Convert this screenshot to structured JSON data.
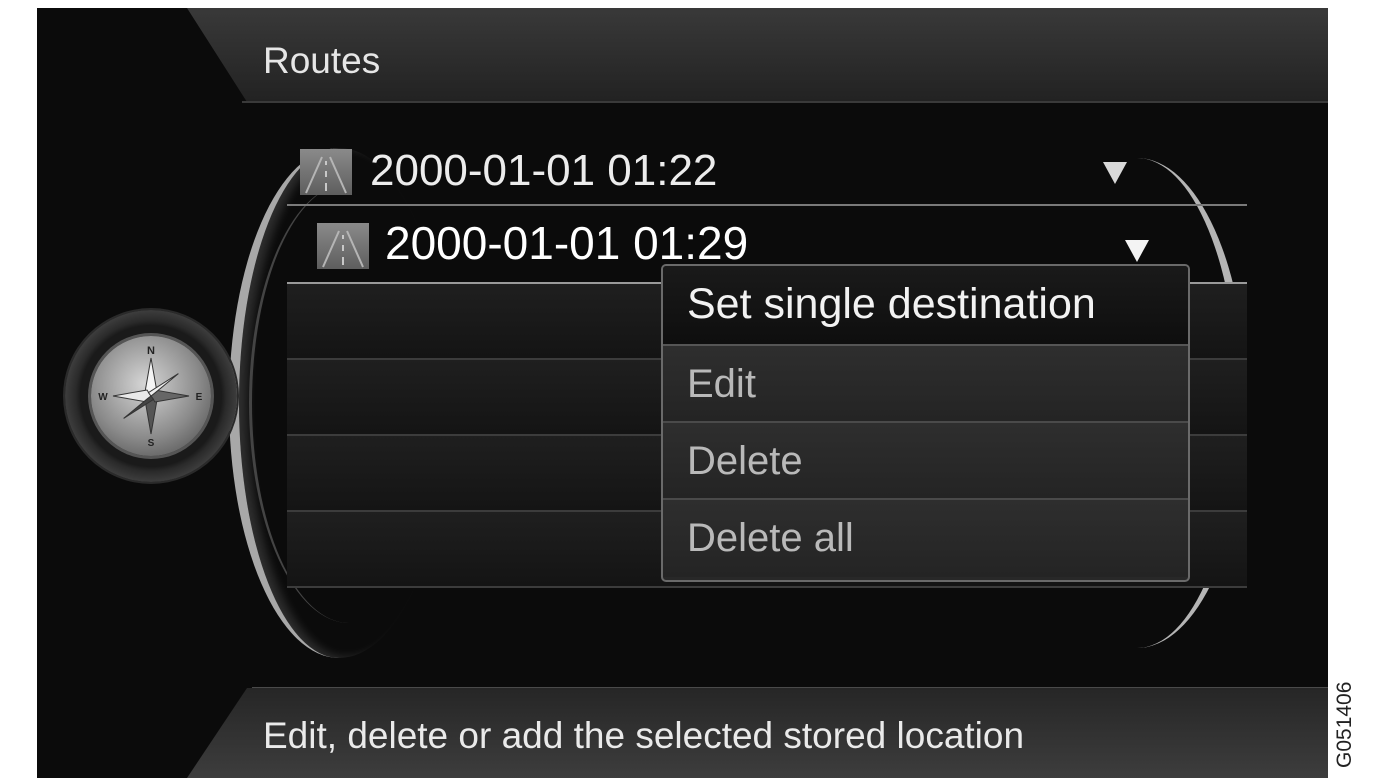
{
  "header": {
    "title": "Routes"
  },
  "routes": [
    {
      "label": "2000-01-01 01:22",
      "icon": "route-icon",
      "expand_icon": "triangle-down-icon"
    },
    {
      "label": "2000-01-01 01:29",
      "icon": "route-icon",
      "expand_icon": "triangle-down-icon",
      "selected": true
    }
  ],
  "context_menu": {
    "items": [
      {
        "label": "Set single destination",
        "selected": true
      },
      {
        "label": "Edit"
      },
      {
        "label": "Delete"
      },
      {
        "label": "Delete all"
      }
    ]
  },
  "compass": {
    "icon": "compass-icon",
    "letters": [
      "N",
      "E",
      "S",
      "W"
    ]
  },
  "status": {
    "text": "Edit, delete or add the selected stored location"
  },
  "figure_code": "G051406"
}
